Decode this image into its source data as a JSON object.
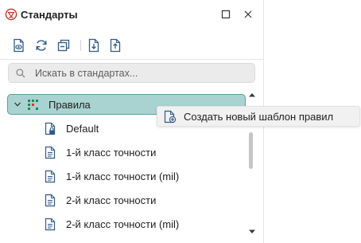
{
  "window": {
    "title": "Стандарты",
    "app_icon": "standards-logo-icon",
    "maximize_icon": "maximize-icon",
    "close_icon": "close-icon"
  },
  "toolbar": {
    "buttons": [
      {
        "icon": "view-standard-icon"
      },
      {
        "icon": "refresh-icon"
      },
      {
        "icon": "collapse-all-icon"
      },
      {
        "icon": "import-icon"
      },
      {
        "icon": "export-icon"
      }
    ]
  },
  "search": {
    "icon": "search-icon",
    "placeholder": "Искать в стандартах...",
    "value": ""
  },
  "tree": {
    "root": {
      "label": "Правила",
      "icon": "rules-grid-icon",
      "expanded": true,
      "selected": true
    },
    "items": [
      {
        "label": "Default",
        "icon": "locked-document-icon"
      },
      {
        "label": "1-й класс точности",
        "icon": "document-icon"
      },
      {
        "label": "1-й класс точности (mil)",
        "icon": "document-icon"
      },
      {
        "label": "2-й класс точности",
        "icon": "document-icon"
      },
      {
        "label": "2-й класс точности (mil)",
        "icon": "document-icon"
      }
    ]
  },
  "context_menu": {
    "items": [
      {
        "label": "Создать новый шаблон правил",
        "icon": "new-template-icon"
      }
    ]
  },
  "colors": {
    "accent": "#5b9f9c",
    "selection_fill": "#a9d3d1",
    "icon_blue": "#2f5a8a",
    "logo_red": "#c0392b"
  }
}
